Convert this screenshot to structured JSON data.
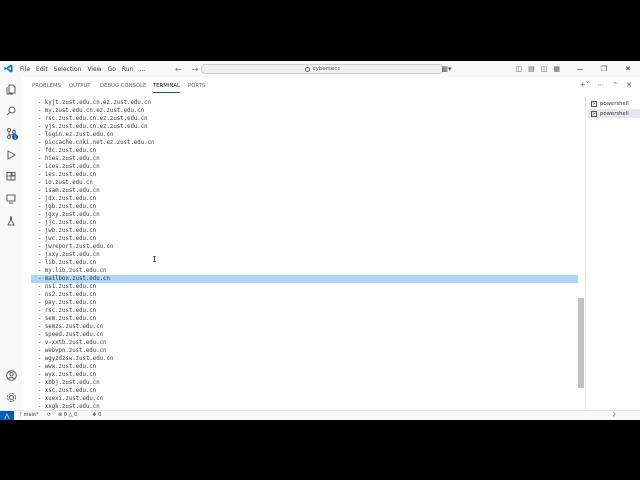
{
  "menu": [
    "File",
    "Edit",
    "Selection",
    "View",
    "Go",
    "Run",
    "…"
  ],
  "search": {
    "text": "cybersecc"
  },
  "panel_tabs": [
    "PROBLEMS",
    "OUTPUT",
    "DEBUG CONSOLE",
    "TERMINAL",
    "PORTS"
  ],
  "active_tab": "TERMINAL",
  "terminal_lines": [
    "- kyjt.zust.edu.cn.ez.zust.edu.cn",
    "- my.zust.edu.cn.ez.zust.edu.cn",
    "- rsc.zust.edu.cn.ez.zust.edu.cn",
    "- yjs.zust.edu.cn.ez.zust.edu.cn",
    "- login.ez.zust.edu.cn",
    "- piccache.cnki.net.ez.zust.edu.cn",
    "- fdc.zust.edu.cn",
    "- hies.zust.edu.cn",
    "- ices.zust.edu.cn",
    "- ies.zust.edu.cn",
    "- io.zust.edu.cn",
    "- isam.zust.edu.cn",
    "- jdx.zust.edu.cn",
    "- jgb.zust.edu.cn",
    "- jgxy.zust.edu.cn",
    "- jjc.zust.edu.cn",
    "- jwb.zust.edu.cn",
    "- jwc.zust.edu.cn",
    "- jwreport.zust.edu.cn",
    "- jxxy.zust.edu.cn",
    "- lib.zust.edu.cn",
    "- my.lib.zust.edu.cn",
    "- mailbox.zust.edu.cn",
    "- ns1.zust.edu.cn",
    "- ns2.zust.edu.cn",
    "- pay.zust.edu.cn",
    "- rsc.zust.edu.cn",
    "- sem.zust.edu.cn",
    "- semzs.zust.edu.cn",
    "- speed.zust.edu.cn",
    "- v-xxtb.zust.edu.cn",
    "- webvpn.zust.edu.cn",
    "- wgyzdzsw.zust.edu.cn",
    "- www.zust.edu.cn",
    "- wyx.zust.edu.cn",
    "- xbbj.zust.edu.cn",
    "- xsc.zust.edu.cn",
    "- xuexi.zust.edu.cn",
    "- xxgk.zust.edu.cn"
  ],
  "highlighted_line_index": 22,
  "terminals": [
    "powershell",
    "powershell"
  ],
  "status": {
    "branch": "main*",
    "errors": "0",
    "warnings": "0",
    "info": "0"
  },
  "colors": {
    "accent": "#005fb8",
    "selection": "#add6ff"
  }
}
